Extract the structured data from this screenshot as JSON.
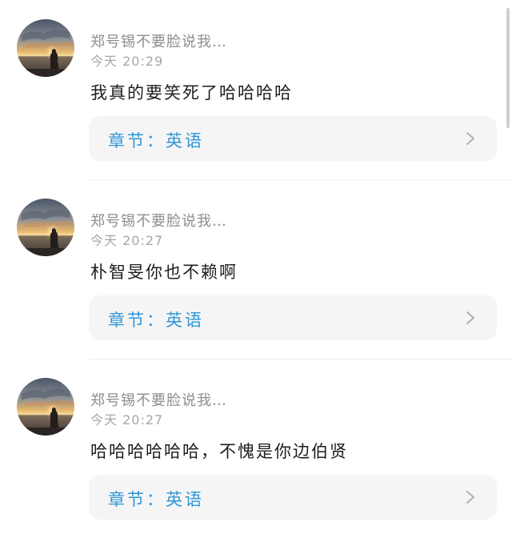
{
  "comments": [
    {
      "username": "郑号锡不要脸说我…",
      "time": "今天 20:29",
      "text": "我真的要笑死了哈哈哈哈",
      "chapter": "章节：英语"
    },
    {
      "username": "郑号锡不要脸说我…",
      "time": "今天 20:27",
      "text": "朴智旻你也不赖啊",
      "chapter": "章节：英语"
    },
    {
      "username": "郑号锡不要脸说我…",
      "time": "今天 20:27",
      "text": "哈哈哈哈哈哈，不愧是你边伯贤",
      "chapter": "章节：英语"
    }
  ],
  "colors": {
    "chapter_text": "#2f96d6",
    "card_background": "#f5f5f5",
    "username": "#8e8e8e",
    "timestamp": "#a6a6a6",
    "body_text": "#1e1e1e"
  },
  "icons": {
    "avatar": "sunset-beach-photo",
    "card_arrow": "chevron-right-icon"
  }
}
